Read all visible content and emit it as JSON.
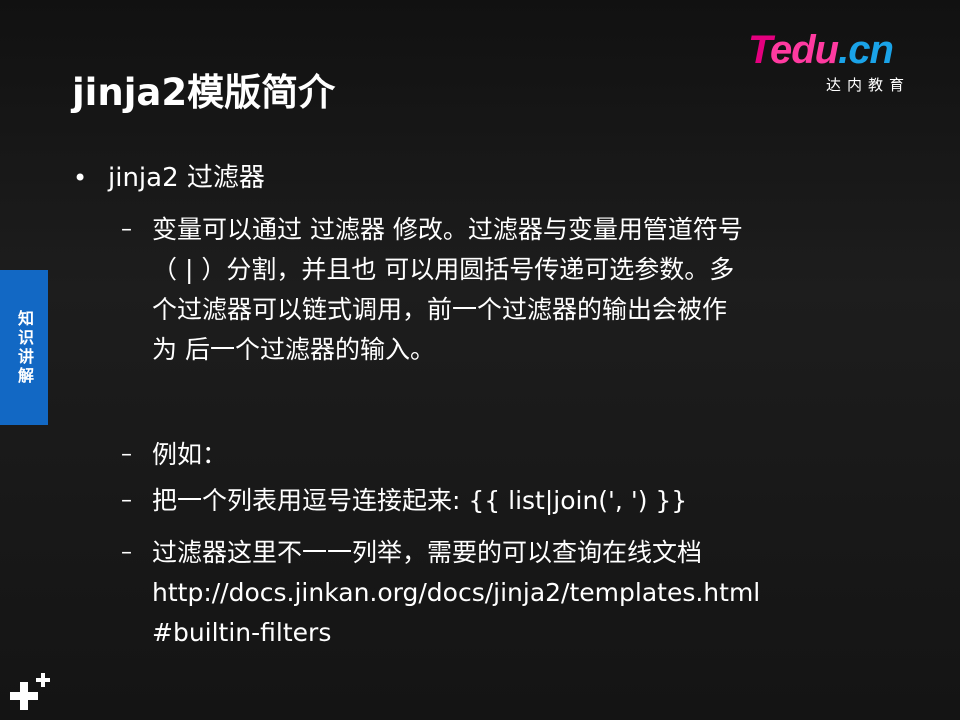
{
  "logo": {
    "word_t": "T",
    "word_edu": "edu",
    "word_dot_cn": ".cn",
    "subtitle": "达内教育"
  },
  "title": "jinja2模版简介",
  "side_tab": "知识讲解",
  "bullet": "jinja2 过滤器",
  "items": {
    "desc_line1": "变量可以通过 过滤器 修改。过滤器与变量用管道符号",
    "desc_line2": "（ | ）分割，并且也 可以用圆括号传递可选参数。多",
    "desc_line3": "个过滤器可以链式调用，前一个过滤器的输出会被作",
    "desc_line4": "为 后一个过滤器的输入。",
    "example": "例如：",
    "join_example": "把一个列表用逗号连接起来:  {{ list|join(', ') }}",
    "docs_line1": "过滤器这里不一一列举，需要的可以查询在线文档",
    "docs_line2": "http://docs.jinkan.org/docs/jinja2/templates.html",
    "docs_line3": "#builtin-filters"
  },
  "colors": {
    "side_tab": "#1268c4",
    "logo_pink": "#e4007f",
    "logo_blue": "#1aa3e8"
  }
}
